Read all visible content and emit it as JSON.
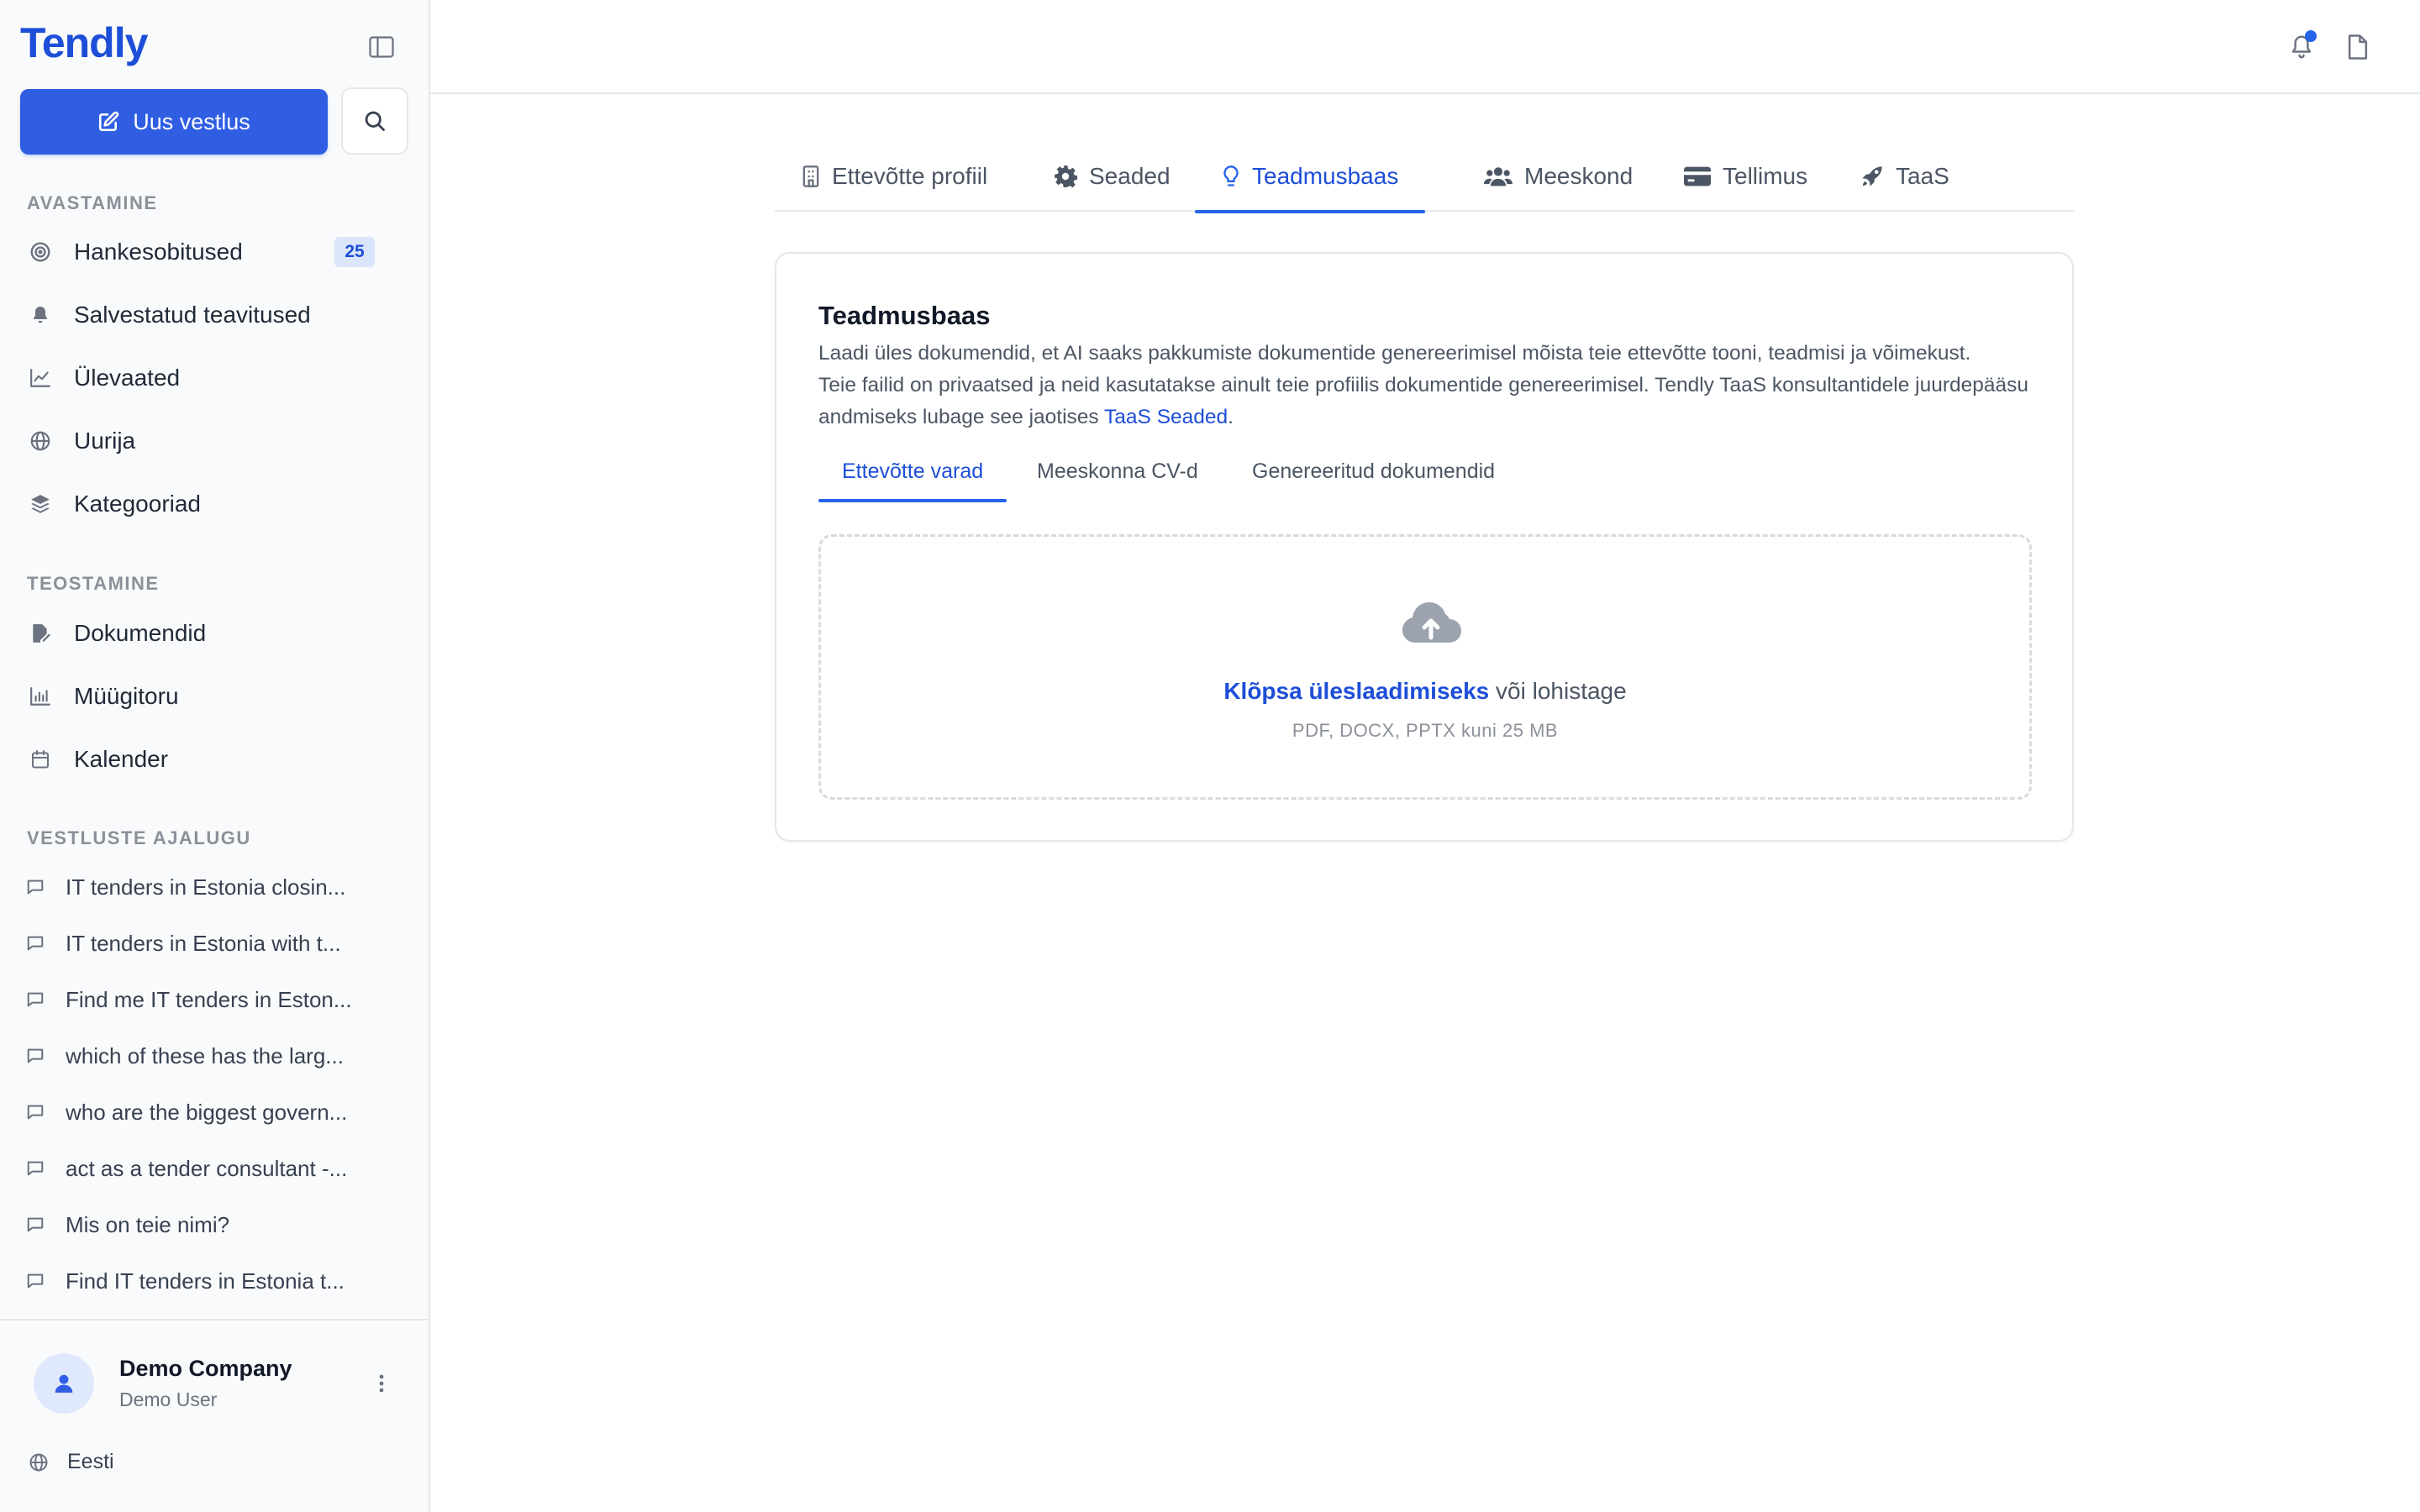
{
  "app": {
    "brand": "Tendly",
    "new_chat_label": "Uus vestlus"
  },
  "sidebar": {
    "sections": [
      {
        "title": "AVASTAMINE"
      },
      {
        "title": "TEOSTAMINE"
      },
      {
        "title": "VESTLUSTE AJALUGU"
      }
    ],
    "discover_items": [
      {
        "label": "Hankesobitused",
        "badge": "25",
        "icon": "target-icon"
      },
      {
        "label": "Salvestatud teavitused",
        "icon": "bell-icon"
      },
      {
        "label": "Ülevaated",
        "icon": "line-chart-icon"
      },
      {
        "label": "Uurija",
        "icon": "globe-icon"
      },
      {
        "label": "Kategooriad",
        "icon": "layers-icon"
      }
    ],
    "execute_items": [
      {
        "label": "Dokumendid",
        "icon": "file-edit-icon"
      },
      {
        "label": "Müügitoru",
        "icon": "bar-chart-icon"
      },
      {
        "label": "Kalender",
        "icon": "calendar-icon"
      }
    ],
    "history": [
      "IT tenders in Estonia closin...",
      "IT tenders in Estonia with t...",
      "Find me IT tenders in Eston...",
      "which of these has the larg...",
      "who are the biggest govern...",
      "act as a tender consultant -...",
      "Mis on teie nimi?",
      "Find IT tenders in Estonia t..."
    ],
    "user": {
      "company": "Demo Company",
      "role": "Demo User"
    },
    "language": "Eesti"
  },
  "tabs": [
    {
      "label": "Ettevõtte profiil",
      "icon": "building-icon",
      "active": false
    },
    {
      "label": "Seaded",
      "icon": "gear-icon",
      "active": false
    },
    {
      "label": "Teadmusbaas",
      "icon": "lightbulb-icon",
      "active": true
    },
    {
      "label": "Meeskond",
      "icon": "users-icon",
      "active": false
    },
    {
      "label": "Tellimus",
      "icon": "credit-card-icon",
      "active": false
    },
    {
      "label": "TaaS",
      "icon": "rocket-icon",
      "active": false
    }
  ],
  "knowledge_base": {
    "title": "Teadmusbaas",
    "description_line1": "Laadi üles dokumendid, et AI saaks pakkumiste dokumentide genereerimisel mõista teie ettevõtte tooni, teadmisi ja võimekust.",
    "description_line2": "Teie failid on privaatsed ja neid kasutatakse ainult teie profiilis dokumentide genereerimisel. Tendly TaaS konsultantidele juurdepääsu andmiseks lubage see jaotises",
    "description_link": "TaaS Seaded",
    "description_end": ".",
    "subtabs": [
      {
        "label": "Ettevõtte varad",
        "active": true
      },
      {
        "label": "Meeskonna CV-d",
        "active": false
      },
      {
        "label": "Genereeritud dokumendid",
        "active": false
      }
    ],
    "upload": {
      "link_text": "Klõpsa üleslaadimiseks",
      "rest_text": "või lohistage",
      "hint": "PDF, DOCX, PPTX kuni 25 MB"
    }
  },
  "colors": {
    "accent": "#2563eb",
    "accent_text": "#1d4ed8",
    "sidebar_bg": "#f9fafb",
    "border": "#e5e7eb"
  }
}
